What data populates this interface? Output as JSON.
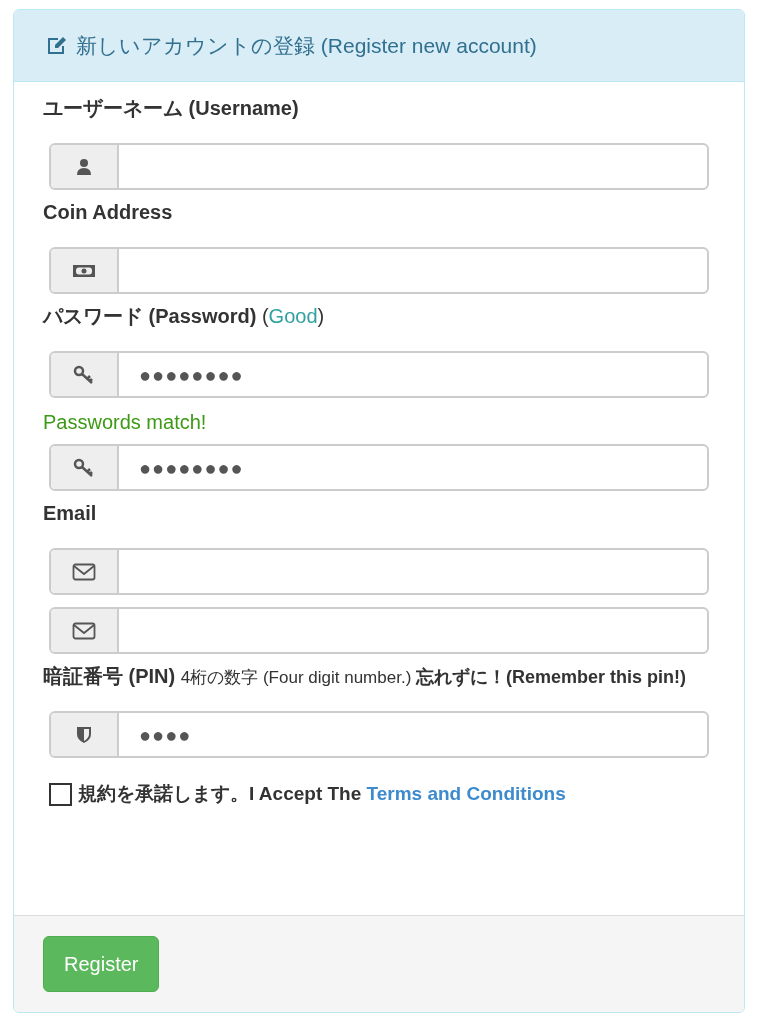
{
  "panel": {
    "title": "新しいアカウントの登録 (Register new account)"
  },
  "items": [
    {
      "kind": "label",
      "parts": [
        {
          "text": "ユーザーネーム (Username)",
          "kind": "bold"
        }
      ]
    },
    {
      "kind": "user-input"
    },
    {
      "kind": "label",
      "parts": [
        {
          "text": "Coin Address",
          "kind": "bold"
        }
      ]
    },
    {
      "kind": "money-input"
    },
    {
      "kind": "label",
      "parts": [
        {
          "text": "パスワード (Password) ",
          "kind": "bold"
        },
        {
          "text": "(",
          "kind": "normal"
        },
        {
          "text": "Good",
          "kind": "good"
        },
        {
          "text": ")",
          "kind": "normal"
        }
      ]
    },
    {
      "kind": "key-input",
      "value": "●●●●●●●●"
    },
    {
      "kind": "message",
      "text": "Passwords match!"
    },
    {
      "kind": "key-input",
      "value": "●●●●●●●●"
    },
    {
      "kind": "label",
      "parts": [
        {
          "text": "Email",
          "kind": "bold"
        }
      ]
    },
    {
      "kind": "mail-input"
    },
    {
      "kind": "mail-input"
    },
    {
      "kind": "label",
      "parts": [
        {
          "text": "暗証番号 (PIN) ",
          "kind": "bold"
        },
        {
          "text": "4桁の数字 (Four digit number.) ",
          "kind": "small"
        },
        {
          "text": "忘れずに！(Remember this pin!)",
          "kind": "small-bold"
        }
      ]
    },
    {
      "kind": "shield-input",
      "value": "●●●●"
    }
  ],
  "terms": {
    "checked": false,
    "text": "規約を承諾します。I Accept The ",
    "link": "Terms and Conditions"
  },
  "footer": {
    "button": "Register"
  }
}
